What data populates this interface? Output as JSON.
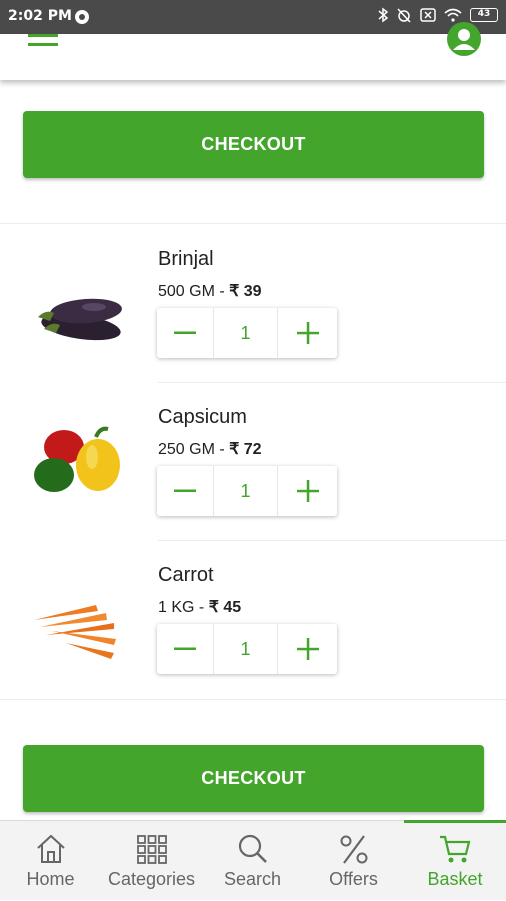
{
  "status_bar": {
    "time": "2:02 PM",
    "battery": "43"
  },
  "colors": {
    "accent": "#43a52b",
    "status_bar": "#4a4a4a"
  },
  "app_bar": {
    "menu_icon": "hamburger-menu-icon",
    "profile_icon": "account-circle-icon"
  },
  "checkout": {
    "top_label": "CHECKOUT",
    "bottom_label": "CHECKOUT"
  },
  "products": [
    {
      "name": "Brinjal",
      "weight": "500 GM - ",
      "price": "₹ 39",
      "quantity": "1",
      "image": "brinjal-image"
    },
    {
      "name": "Capsicum",
      "weight": "250 GM - ",
      "price": "₹ 72",
      "quantity": "1",
      "image": "capsicum-image"
    },
    {
      "name": "Carrot",
      "weight": "1 KG - ",
      "price": "₹ 45",
      "quantity": "1",
      "image": "carrot-image"
    }
  ],
  "bottom_nav": {
    "items": [
      {
        "label": "Home",
        "icon": "home-icon"
      },
      {
        "label": "Categories",
        "icon": "grid-icon"
      },
      {
        "label": "Search",
        "icon": "search-icon"
      },
      {
        "label": "Offers",
        "icon": "percent-icon"
      },
      {
        "label": "Basket",
        "icon": "cart-icon",
        "active": true
      }
    ]
  }
}
